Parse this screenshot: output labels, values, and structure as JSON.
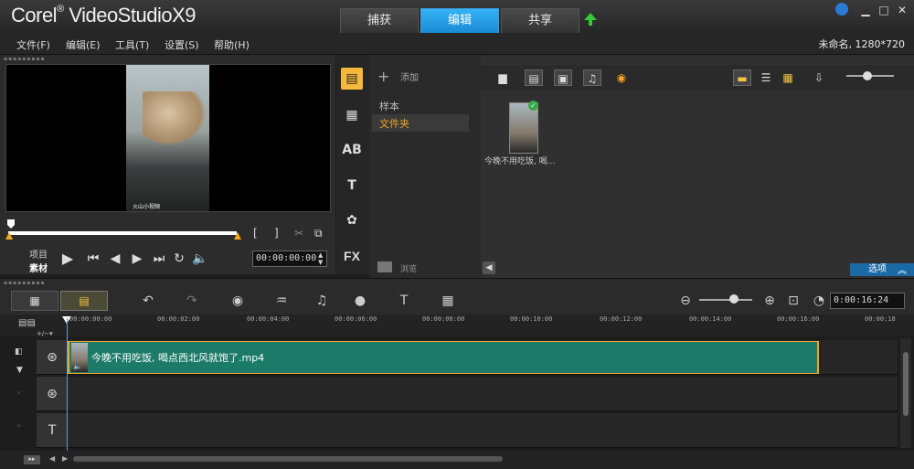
{
  "app": {
    "brand": "Corel",
    "product": "VideoStudio",
    "version": "X9"
  },
  "tabs": [
    {
      "label": "捕获"
    },
    {
      "label": "编辑"
    },
    {
      "label": "共享"
    }
  ],
  "menu": [
    {
      "label": "文件(F)"
    },
    {
      "label": "编辑(E)"
    },
    {
      "label": "工具(T)"
    },
    {
      "label": "设置(S)"
    },
    {
      "label": "帮助(H)"
    }
  ],
  "project_info": "未命名, 1280*720",
  "preview": {
    "mode_project": "项目",
    "mode_clip": "素材",
    "timecode": "00:00:00:00",
    "watermark": "火山小视频",
    "bracket_in": "[",
    "bracket_out": "]"
  },
  "library": {
    "add_label": "添加",
    "folders": [
      {
        "label": "样本"
      },
      {
        "label": "文件夹"
      }
    ],
    "browse_label": "浏览",
    "options_label": "选项",
    "items": [
      {
        "label": "今晚不用吃饭, 喝..."
      }
    ]
  },
  "timeline": {
    "timecode": "0:00:16:24",
    "ruler": [
      "00:00:00:00",
      "00:00:02:00",
      "00:00:04:00",
      "00:00:06:00",
      "00:00:08:00",
      "00:00:10:00",
      "00:00:12:00",
      "00:00:14:00",
      "00:00:16:00",
      "00:00:18"
    ],
    "clip_label": "今晚不用吃饭, 喝点西北风就饱了.mp4"
  },
  "colors": {
    "accent": "#1a8ad5",
    "clip": "#1c7a68",
    "highlight": "#f5a623"
  }
}
